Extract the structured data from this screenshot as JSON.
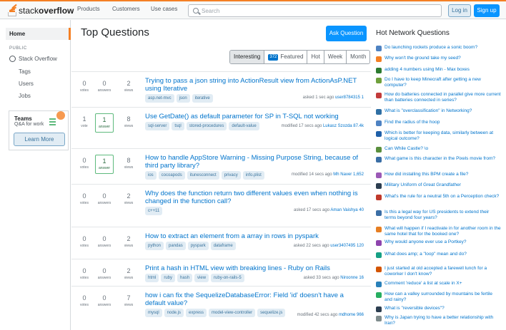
{
  "topbar": {
    "logo_light": "stack",
    "logo_bold": "overflow",
    "nav": [
      "Products",
      "Customers",
      "Use cases"
    ],
    "search_placeholder": "Search",
    "login_label": "Log in",
    "signup_label": "Sign up"
  },
  "sidebar": {
    "home_label": "Home",
    "public_label": "PUBLIC",
    "stackoverflow_label": "Stack Overflow",
    "items": [
      "Tags",
      "Users",
      "Jobs"
    ],
    "teams": {
      "title": "Teams",
      "subtitle": "Q&A for work",
      "button_label": "Learn More"
    }
  },
  "main": {
    "title": "Top Questions",
    "ask_button_label": "Ask Question",
    "tabs": [
      {
        "label": "Interesting",
        "badge": ""
      },
      {
        "label": "Featured",
        "badge": "372"
      },
      {
        "label": "Hot",
        "badge": ""
      },
      {
        "label": "Week",
        "badge": ""
      },
      {
        "label": "Month",
        "badge": ""
      }
    ],
    "questions": [
      {
        "votes": "0",
        "votes_label": "votes",
        "answers": "0",
        "answers_label": "answers",
        "views": "2",
        "views_label": "views",
        "title": "Trying to pass a json string into ActionResult view from ActionAsP.NET using Iterative",
        "tags": [
          "asp.net-mvc",
          "json",
          "iterative"
        ],
        "meta": "asked 1 sec ago",
        "user": "user8784315 1"
      },
      {
        "votes": "1",
        "votes_label": "vote",
        "answers": "1",
        "answers_label": "answer",
        "views": "8",
        "views_label": "views",
        "title": "Use GetDate() as default parameter for SP in T-SQL not working",
        "tags": [
          "sql-server",
          "tsql",
          "stored-procedures",
          "default-value"
        ],
        "meta": "modified 17 secs ago",
        "user": "Lukasz Szozda 87.4k"
      },
      {
        "votes": "0",
        "votes_label": "votes",
        "answers": "1",
        "answers_label": "answer",
        "views": "8",
        "views_label": "views",
        "title": "How to handle AppStore Warning - Missing Purpose String, because of third party library?",
        "tags": [
          "ios",
          "cocoapods",
          "itunesconnect",
          "privacy",
          "info.plist"
        ],
        "meta": "modified 14 secs ago",
        "user": "Mh Naver 1,652"
      },
      {
        "votes": "0",
        "votes_label": "votes",
        "answers": "0",
        "answers_label": "answers",
        "views": "2",
        "views_label": "views",
        "title": "Why does the function return two different values even when nothing is changed in the function call?",
        "tags": [
          "c++11"
        ],
        "meta": "asked 17 secs ago",
        "user": "Aman Vaishya 40"
      },
      {
        "votes": "0",
        "votes_label": "votes",
        "answers": "0",
        "answers_label": "answers",
        "views": "2",
        "views_label": "views",
        "title": "How to extract an element from a array in rows in pyspark",
        "tags": [
          "python",
          "pandas",
          "pyspark",
          "dataframe"
        ],
        "meta": "asked 22 secs ago",
        "user": "user3407495 120"
      },
      {
        "votes": "0",
        "votes_label": "votes",
        "answers": "0",
        "answers_label": "answers",
        "views": "2",
        "views_label": "views",
        "title": "Print a hash in HTML view with breaking lines - Ruby on Rails",
        "tags": [
          "html",
          "ruby",
          "hash",
          "view",
          "ruby-on-rails-5"
        ],
        "meta": "asked 33 secs ago",
        "user": "Niroonne 16"
      },
      {
        "votes": "0",
        "votes_label": "votes",
        "answers": "0",
        "answers_label": "answers",
        "views": "7",
        "views_label": "views",
        "title": "how i can fix the SequelizeDatabaseError: Field 'id' doesn't have a default value?",
        "tags": [
          "mysql",
          "node.js",
          "express",
          "model-view-controller",
          "sequelize.js"
        ],
        "meta": "modified 42 secs ago",
        "user": "mdhome 966"
      }
    ]
  },
  "hot_network": {
    "title": "Hot Network Questions",
    "items": [
      {
        "text": "Do launching rockets produce a sonic boom?",
        "color": "#4e82c2"
      },
      {
        "text": "Why won't the ground take my seed?",
        "color": "#f48024"
      },
      {
        "text": "adding 4 numbers using Min - Max boxes",
        "color": "#2c7a2f"
      },
      {
        "text": "Do I have to keep Minecraft after getting a new computer?",
        "color": "#6fa03c"
      },
      {
        "text": "How do batteries connected in parallel give more current than batteries connected in series?",
        "color": "#c23b3b"
      },
      {
        "text": "What is \"overclassification\" in Networking?",
        "color": "#2f6fa3"
      },
      {
        "text": "Find the radius of the hoop",
        "color": "#4e82c2"
      },
      {
        "text": "Which is better for keeping data, similarly between at logical outcome?",
        "color": "#1e5fa8"
      },
      {
        "text": "Can While Castle? \\o",
        "color": "#5a8f3c"
      },
      {
        "text": "What game is this character in the Pixels movie from?",
        "color": "#3a6ea5"
      },
      {
        "text": "How did installing this BPM create a file?",
        "color": "#9b59b6"
      },
      {
        "text": "Military Uniform of Great Grandfather",
        "color": "#2c3e50"
      },
      {
        "text": "What's the rule for a neutral 5th on a Perception check?",
        "color": "#c0392b"
      },
      {
        "text": "Is this a legal way for US presidents to extend their terms beyond four years?",
        "color": "#3b6ea5"
      },
      {
        "text": "What will happen if I reactivate in for another room in the same hotel that for the booked one?",
        "color": "#e67e22"
      },
      {
        "text": "Why would anyone ever use a Portkey?",
        "color": "#8e44ad"
      },
      {
        "text": "What does amp; a \"loop\" mean and do?",
        "color": "#16a085"
      },
      {
        "text": "I just started at old accepted a farewell lunch for a coworker I don't know?",
        "color": "#d35400"
      },
      {
        "text": "Comment 'reduce' a list at scale in X+",
        "color": "#2980b9"
      },
      {
        "text": "How can a valley surrounded by mountains be fertile and rainy?",
        "color": "#27ae60"
      },
      {
        "text": "What is \"reversible devices\"?",
        "color": "#2c3e50"
      },
      {
        "text": "Why is Japan trying to have a better relationship with Iran?",
        "color": "#7f8c8d"
      }
    ]
  }
}
